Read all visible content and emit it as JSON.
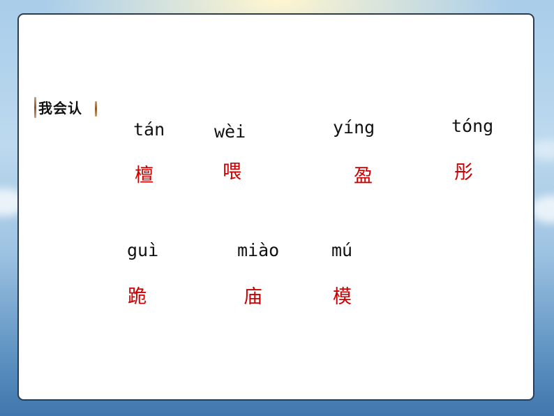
{
  "section_label": "我会认",
  "characters": [
    {
      "pinyin": "tán",
      "hanzi": "檀"
    },
    {
      "pinyin": "wèi",
      "hanzi": "喂"
    },
    {
      "pinyin": "yíng",
      "hanzi": "盈"
    },
    {
      "pinyin": "tóng",
      "hanzi": "彤"
    },
    {
      "pinyin": "guì",
      "hanzi": "跪"
    },
    {
      "pinyin": "miào",
      "hanzi": "庙"
    },
    {
      "pinyin": "mú",
      "hanzi": "模"
    }
  ],
  "colors": {
    "pinyin": "#111111",
    "hanzi": "#cc0000",
    "slide_border": "#2f3b4d"
  }
}
